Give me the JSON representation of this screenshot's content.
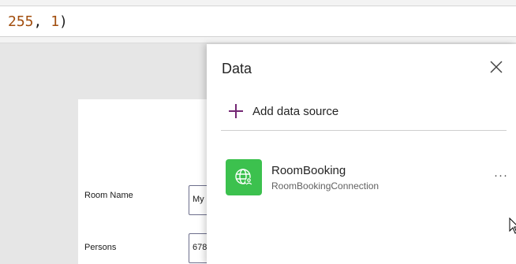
{
  "formula_bar": {
    "num_text": "255",
    "sep_text": ", ",
    "num2_text": "1",
    "tail_text": ")"
  },
  "form": {
    "room_name_label": "Room Name",
    "room_name_value": "My",
    "persons_label": "Persons",
    "persons_value": "678"
  },
  "data_pane": {
    "title": "Data",
    "add_source_label": "Add data source",
    "sources": [
      {
        "name": "RoomBooking",
        "connection": "RoomBookingConnection",
        "icon": "globe-user-icon"
      }
    ],
    "more_label": "···"
  },
  "colors": {
    "accent": "#742774",
    "source_icon_bg": "#3cc14e",
    "number_color": "#a14d0d"
  }
}
